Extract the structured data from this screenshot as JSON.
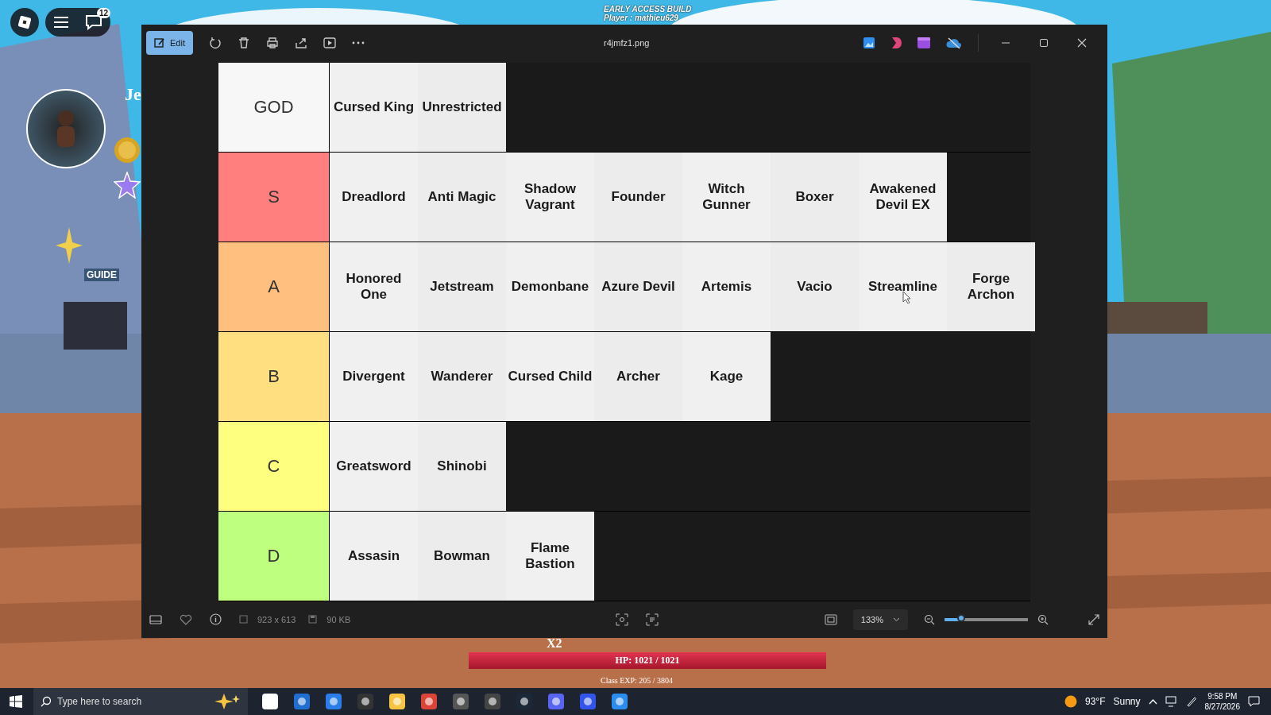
{
  "game_hud": {
    "notification_count": "12",
    "player_initial": "Je",
    "guide_label": "GUIDE",
    "build_notice": "EARLY ACCESS BUILD",
    "player_name": "Player : mathieu629",
    "multiplier": "X2",
    "hp": "HP: 1021 / 1021",
    "class_exp": "Class EXP: 205 / 3804"
  },
  "window": {
    "title": "r4jmfz1.png",
    "edit_label": "Edit"
  },
  "tiers": [
    {
      "label": "GOD",
      "color": "#f7f7f7",
      "items": [
        "Cursed King",
        "Unrestricted"
      ]
    },
    {
      "label": "S",
      "color": "#ff7f7f",
      "items": [
        "Dreadlord",
        "Anti Magic",
        "Shadow Vagrant",
        "Founder",
        "Witch Gunner",
        "Boxer",
        "Awakened Devil EX"
      ]
    },
    {
      "label": "A",
      "color": "#ffbf7f",
      "items": [
        "Honored One",
        "Jetstream",
        "Demonbane",
        "Azure Devil",
        "Artemis",
        "Vacio",
        "Streamline",
        "Forge Archon"
      ]
    },
    {
      "label": "B",
      "color": "#ffdf7f",
      "items": [
        "Divergent",
        "Wanderer",
        "Cursed Child",
        "Archer",
        "Kage"
      ]
    },
    {
      "label": "C",
      "color": "#ffff7f",
      "items": [
        "Greatsword",
        "Shinobi"
      ]
    },
    {
      "label": "D",
      "color": "#bfff7f",
      "items": [
        "Assasin",
        "Bowman",
        "Flame Bastion"
      ]
    }
  ],
  "info_bar": {
    "dimensions": "923 x 613",
    "file_size": "90 KB",
    "zoom": "133%",
    "zoom_slider": {
      "level": 0.2
    }
  },
  "taskbar": {
    "search_placeholder": "Type here to search",
    "temperature": "93°F",
    "weather": "Sunny",
    "time": "9:58 PM",
    "date": "8/27/2026"
  }
}
